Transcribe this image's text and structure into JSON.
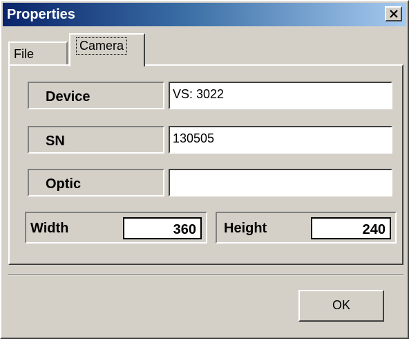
{
  "window": {
    "title": "Properties"
  },
  "tabs": [
    {
      "label": "File"
    },
    {
      "label": "Camera"
    }
  ],
  "camera": {
    "device": {
      "label": "Device",
      "value": "VS: 3022"
    },
    "sn": {
      "label": "SN",
      "value": "130505"
    },
    "optic": {
      "label": "Optic",
      "value": ""
    },
    "width": {
      "label": "Width",
      "value": "360"
    },
    "height": {
      "label": "Height",
      "value": "240"
    }
  },
  "buttons": {
    "ok": "OK"
  }
}
